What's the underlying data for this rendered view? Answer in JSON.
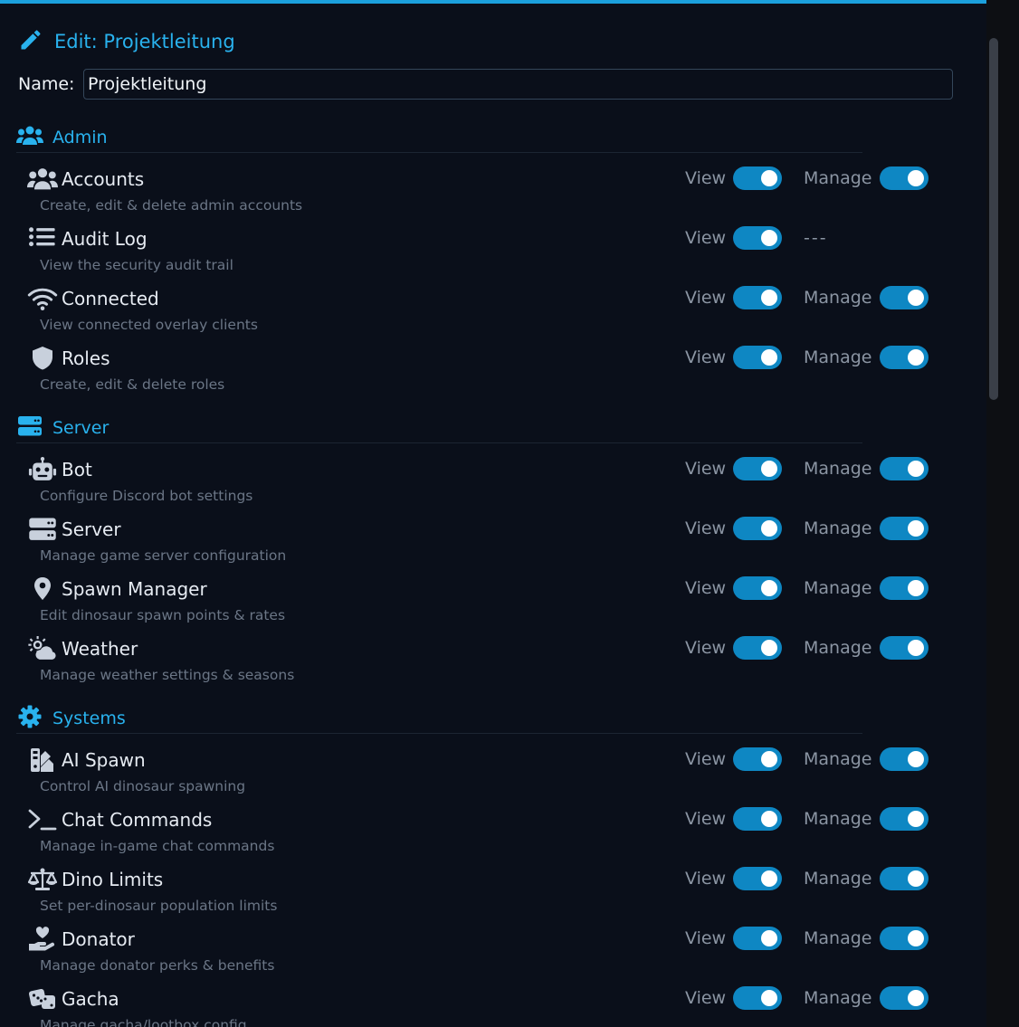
{
  "header": {
    "title": "Edit: Projektleitung"
  },
  "name_field": {
    "label": "Name:",
    "value": "Projektleitung"
  },
  "controls": {
    "view_label": "View",
    "manage_label": "Manage",
    "no_manage": "---"
  },
  "colors": {
    "accent": "#29b2ee",
    "toggle_on": "#0e87c3",
    "background": "#0a0f1a"
  },
  "sections": [
    {
      "title": "Admin",
      "icon": "users-icon",
      "permissions": [
        {
          "title": "Accounts",
          "desc": "Create, edit & delete admin accounts",
          "icon": "users-icon",
          "view": true,
          "manage": true
        },
        {
          "title": "Audit Log",
          "desc": "View the security audit trail",
          "icon": "list-icon",
          "view": true,
          "manage": null
        },
        {
          "title": "Connected",
          "desc": "View connected overlay clients",
          "icon": "wifi-icon",
          "view": true,
          "manage": true
        },
        {
          "title": "Roles",
          "desc": "Create, edit & delete roles",
          "icon": "shield-icon",
          "view": true,
          "manage": true
        }
      ]
    },
    {
      "title": "Server",
      "icon": "server-icon",
      "permissions": [
        {
          "title": "Bot",
          "desc": "Configure Discord bot settings",
          "icon": "robot-icon",
          "view": true,
          "manage": true
        },
        {
          "title": "Server",
          "desc": "Manage game server configuration",
          "icon": "server-icon",
          "view": true,
          "manage": true
        },
        {
          "title": "Spawn Manager",
          "desc": "Edit dinosaur spawn points & rates",
          "icon": "map-pin-icon",
          "view": true,
          "manage": true
        },
        {
          "title": "Weather",
          "desc": "Manage weather settings & seasons",
          "icon": "cloud-sun-icon",
          "view": true,
          "manage": true
        }
      ]
    },
    {
      "title": "Systems",
      "icon": "gear-icon",
      "permissions": [
        {
          "title": "AI Spawn",
          "desc": "Control AI dinosaur spawning",
          "icon": "swatchbook-icon",
          "view": true,
          "manage": true
        },
        {
          "title": "Chat Commands",
          "desc": "Manage in-game chat commands",
          "icon": "terminal-icon",
          "view": true,
          "manage": true
        },
        {
          "title": "Dino Limits",
          "desc": "Set per-dinosaur population limits",
          "icon": "scale-icon",
          "view": true,
          "manage": true
        },
        {
          "title": "Donator",
          "desc": "Manage donator perks & benefits",
          "icon": "hand-heart-icon",
          "view": true,
          "manage": true
        },
        {
          "title": "Gacha",
          "desc": "Manage gacha/lootbox config",
          "icon": "dice-icon",
          "view": true,
          "manage": true
        }
      ]
    }
  ]
}
